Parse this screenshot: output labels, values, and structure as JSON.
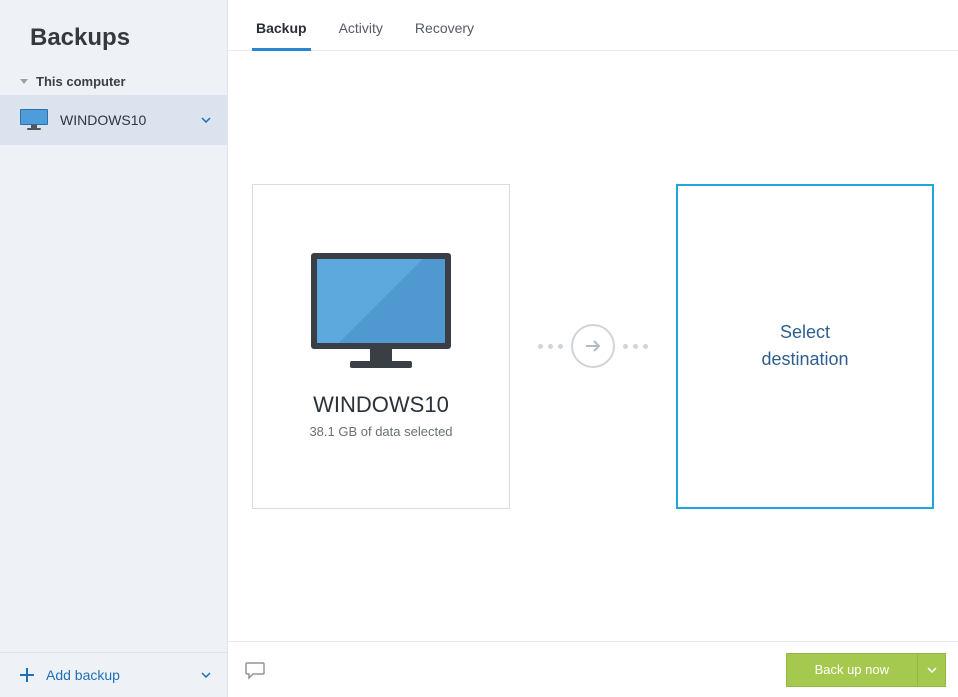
{
  "sidebar": {
    "title": "Backups",
    "section_label": "This computer",
    "item": {
      "label": "WINDOWS10"
    },
    "add_backup_label": "Add backup"
  },
  "tabs": {
    "backup": "Backup",
    "activity": "Activity",
    "recovery": "Recovery"
  },
  "source_card": {
    "title": "WINDOWS10",
    "subtitle": "38.1 GB of data selected"
  },
  "dest_card": {
    "line1": "Select",
    "line2": "destination"
  },
  "bottom": {
    "button_label": "Back up now"
  }
}
